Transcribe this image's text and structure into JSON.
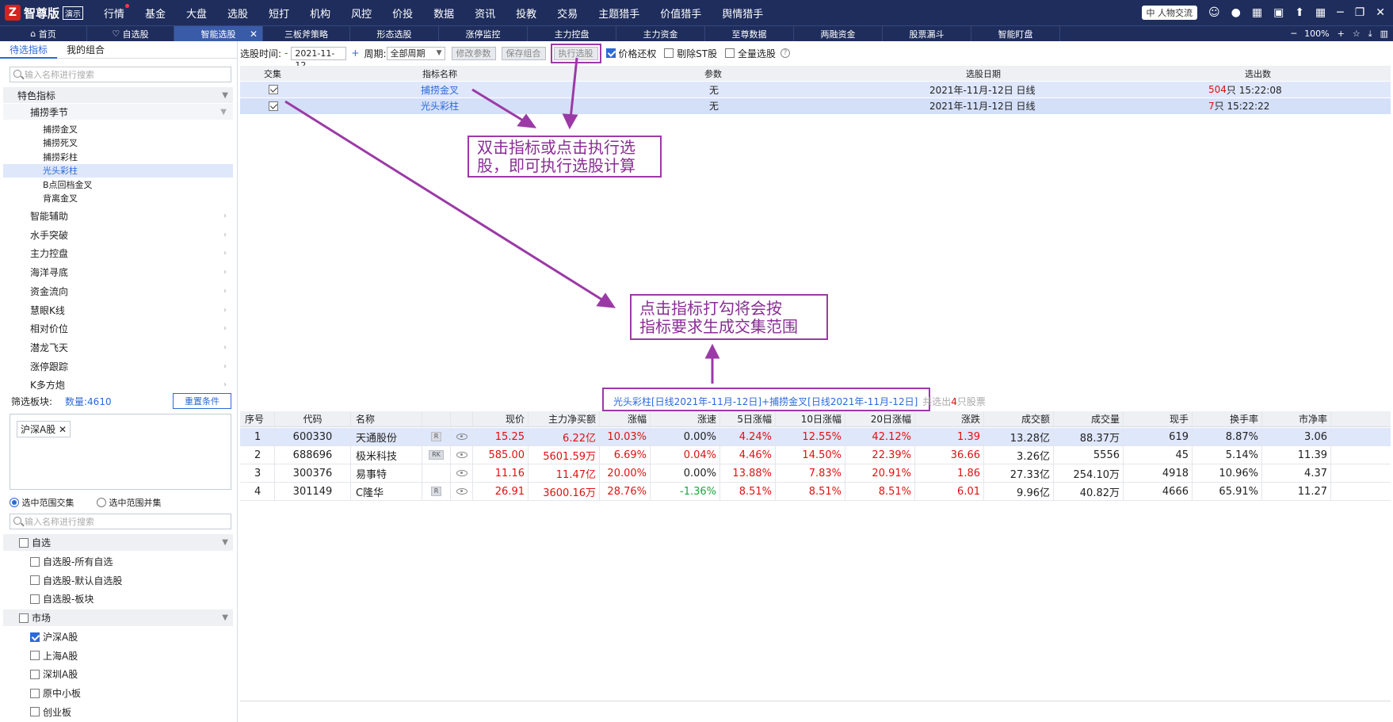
{
  "app": {
    "logo_mark": "Z",
    "logo_text": "智尊版",
    "logo_badge": "演示",
    "main_nav": [
      {
        "label": "行情",
        "dot": true
      },
      {
        "label": "基金"
      },
      {
        "label": "大盘"
      },
      {
        "label": "选股"
      },
      {
        "label": "短打"
      },
      {
        "label": "机构"
      },
      {
        "label": "风控"
      },
      {
        "label": "价投"
      },
      {
        "label": "数据"
      },
      {
        "label": "资讯"
      },
      {
        "label": "投教"
      },
      {
        "label": "交易"
      },
      {
        "label": "主题猎手"
      },
      {
        "label": "价值猎手"
      },
      {
        "label": "舆情猎手"
      }
    ],
    "ime": {
      "label": "中",
      "badge": "人物交流"
    }
  },
  "tabs": {
    "home": "首页",
    "watchlist": "自选股",
    "smart": "智能选股",
    "items": [
      "三板斧策略",
      "形态选股",
      "涨停监控",
      "主力控盘",
      "主力资金",
      "至尊数据",
      "两融资金",
      "股票漏斗",
      "智能盯盘"
    ],
    "zoom": "100%"
  },
  "left": {
    "subtabs": [
      "待选指标",
      "我的组合"
    ],
    "search_placeholder": "输入名称进行搜索",
    "group_title": "特色指标",
    "subgroup": "捕捞季节",
    "leaves": [
      "捕捞金叉",
      "捕捞死叉",
      "捕捞彩柱",
      "光头彩柱",
      "B点回档金叉",
      "背离金叉"
    ],
    "categories": [
      "智能辅助",
      "水手突破",
      "主力控盘",
      "海洋寻底",
      "资金流向",
      "慧眼K线",
      "相对价位",
      "潜龙飞天",
      "涨停跟踪",
      "K多方炮"
    ],
    "filter_label": "筛选板块:",
    "count_label": "数量:4610",
    "reset_button": "重置条件",
    "tag": "沪深A股",
    "radio_intersection": "选中范围交集",
    "radio_union": "选中范围并集",
    "search2_placeholder": "输入名称进行搜索",
    "filter_group1": "自选",
    "filter_items1": [
      "自选股-所有自选",
      "自选股-默认自选股",
      "自选股-板块"
    ],
    "filter_group2": "市场",
    "filter_items2": [
      {
        "label": "沪深A股",
        "checked": true
      },
      {
        "label": "上海A股",
        "checked": false
      },
      {
        "label": "深圳A股",
        "checked": false
      },
      {
        "label": "原中小板",
        "checked": false
      },
      {
        "label": "创业板",
        "checked": false
      }
    ]
  },
  "toolbar": {
    "date_label": "选股时间:",
    "minus": "-",
    "date_value": "2021-11-12",
    "plus": "+",
    "period_label": "周期:",
    "period_value": "全部周期",
    "btn_modify": "修改参数",
    "btn_save": "保存组合",
    "btn_exec": "执行选股",
    "chk_price_restore": "价格还权",
    "chk_exclude_st": "剔除ST股",
    "chk_all": "全量选股",
    "help": "?"
  },
  "table1": {
    "headers": [
      "交集",
      "指标名称",
      "参数",
      "选股日期",
      "选出数"
    ],
    "rows": [
      {
        "name": "捕捞金叉",
        "param": "无",
        "date": "2021年-11月-12日 日线",
        "count": "504",
        "count_suffix": "只 15:22:08"
      },
      {
        "name": "光头彩柱",
        "param": "无",
        "date": "2021年-11月-12日 日线",
        "count": "7",
        "count_suffix": "只 15:22:22"
      }
    ]
  },
  "annotations": {
    "a1_line1": "双击指标或点击执行选",
    "a1_line2": "股，即可执行选股计算",
    "a2_line1": "点击指标打勾将会按",
    "a2_line2": "指标要求生成交集范围"
  },
  "formula": {
    "text": "光头彩柱[日线2021年-11月-12日]+捕捞金叉[日线2021年-11月-12日]",
    "result_prefix": "共选出",
    "result_count": "4",
    "result_suffix": "只股票"
  },
  "table2": {
    "headers": [
      "序号",
      "代码",
      "名称",
      "",
      "",
      "现价",
      "主力净买额",
      "涨幅",
      "涨速",
      "5日涨幅",
      "10日涨幅",
      "20日涨幅",
      "涨跌",
      "成交额",
      "成交量",
      "现手",
      "换手率",
      "市净率"
    ],
    "rows": [
      {
        "idx": "1",
        "code": "600330",
        "name": "天通股份",
        "badge": "R",
        "price": "15.25",
        "net": "6.22亿",
        "chg": "10.03%",
        "speed": "0.00%",
        "d5": "4.24%",
        "d10": "12.55%",
        "d20": "42.12%",
        "diff": "1.39",
        "amount": "13.28亿",
        "volume": "88.37万",
        "hand": "619",
        "turnover": "8.87%",
        "pb": "3.06",
        "speed_color": "black"
      },
      {
        "idx": "2",
        "code": "688696",
        "name": "极米科技",
        "badge": "RK",
        "price": "585.00",
        "net": "5601.59万",
        "chg": "6.69%",
        "speed": "0.04%",
        "d5": "4.46%",
        "d10": "14.50%",
        "d20": "22.39%",
        "diff": "36.66",
        "amount": "3.26亿",
        "volume": "5556",
        "hand": "45",
        "turnover": "5.14%",
        "pb": "11.39",
        "speed_color": "red"
      },
      {
        "idx": "3",
        "code": "300376",
        "name": "易事特",
        "badge": "",
        "price": "11.16",
        "net": "11.47亿",
        "chg": "20.00%",
        "speed": "0.00%",
        "d5": "13.88%",
        "d10": "7.83%",
        "d20": "20.91%",
        "diff": "1.86",
        "amount": "27.33亿",
        "volume": "254.10万",
        "hand": "4918",
        "turnover": "10.96%",
        "pb": "4.37",
        "speed_color": "black"
      },
      {
        "idx": "4",
        "code": "301149",
        "name": "C隆华",
        "badge": "R",
        "price": "26.91",
        "net": "3600.16万",
        "chg": "28.76%",
        "speed": "-1.36%",
        "d5": "8.51%",
        "d10": "8.51%",
        "d20": "8.51%",
        "diff": "6.01",
        "amount": "9.96亿",
        "volume": "40.82万",
        "hand": "4666",
        "turnover": "65.91%",
        "pb": "11.27",
        "speed_color": "green"
      }
    ]
  },
  "colors": {
    "nav_bg": "#1e2d5c",
    "accent": "#2a6ad8",
    "annotation": "#9b3aa6",
    "up": "#e01010",
    "down": "#14a83a"
  }
}
